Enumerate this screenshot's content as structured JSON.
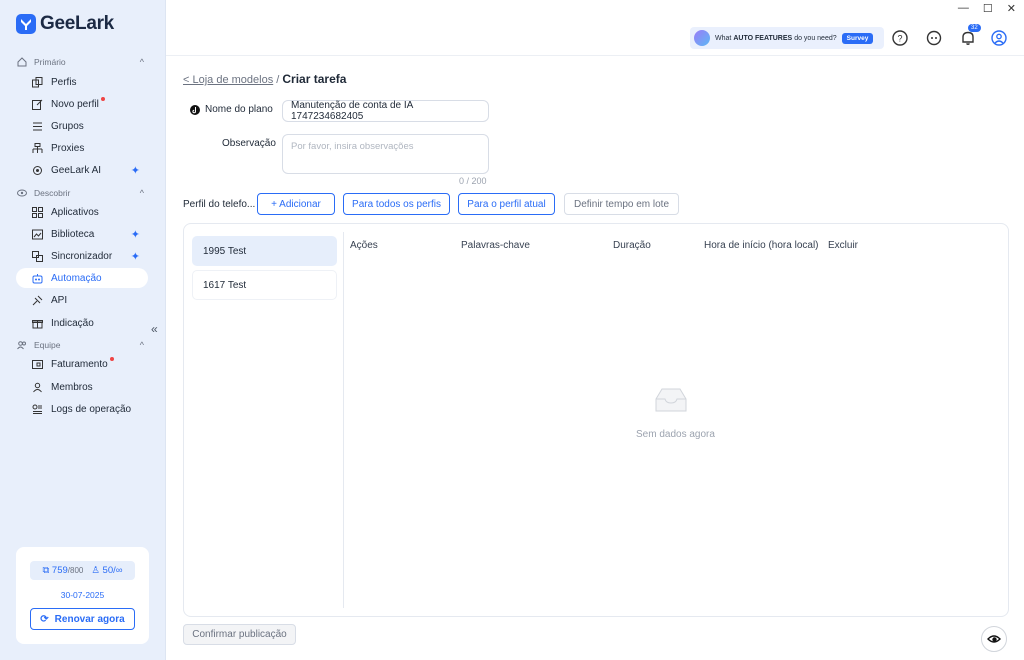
{
  "app": {
    "name": "GeeLark"
  },
  "sidebar": {
    "sections": [
      {
        "label": "Primário"
      },
      {
        "label": "Descobrir"
      },
      {
        "label": "Equipe"
      }
    ],
    "items": [
      {
        "label": "Perfis"
      },
      {
        "label": "Novo perfil"
      },
      {
        "label": "Grupos"
      },
      {
        "label": "Proxies"
      },
      {
        "label": "GeeLark AI"
      },
      {
        "label": "Aplicativos"
      },
      {
        "label": "Biblioteca"
      },
      {
        "label": "Sincronizador"
      },
      {
        "label": "Automação"
      },
      {
        "label": "API"
      },
      {
        "label": "Indicação"
      },
      {
        "label": "Faturamento"
      },
      {
        "label": "Membros"
      },
      {
        "label": "Logs de operação"
      }
    ],
    "collapse_glyph": "«",
    "plan": {
      "profiles_used": "759",
      "profiles_total": "/800",
      "members": "50/∞",
      "date": "30-07-2025",
      "renew_label": "Renovar agora"
    }
  },
  "topbar": {
    "survey_prefix": "What",
    "survey_bold": "AUTO FEATURES",
    "survey_suffix": "do you need?",
    "survey_button": "Survey",
    "notifications_count": "32"
  },
  "main": {
    "breadcrumb_back": "< Loja de modelos",
    "breadcrumb_sep": " / ",
    "breadcrumb_current": "Criar tarefa",
    "plan_name_label": "Nome do plano",
    "plan_name_value": "Manutenção de conta de IA 1747234682405",
    "note_label": "Observação",
    "note_placeholder": "Por favor, insira observações",
    "note_counter": "0 / 200",
    "profile_label": "Perfil do telefo...",
    "buttons": {
      "add": "+ Adicionar",
      "all_profiles": "Para todos os perfis",
      "current_profile": "Para o perfil atual",
      "batch_time": "Definir tempo em lote"
    },
    "profiles": [
      "1995 Test",
      "1617 Test"
    ],
    "table_headers": [
      "Ações",
      "Palavras-chave",
      "Duração",
      "Hora de início (hora local)",
      "Excluir"
    ],
    "empty_text": "Sem dados agora",
    "confirm_label": "Confirmar publicação"
  }
}
